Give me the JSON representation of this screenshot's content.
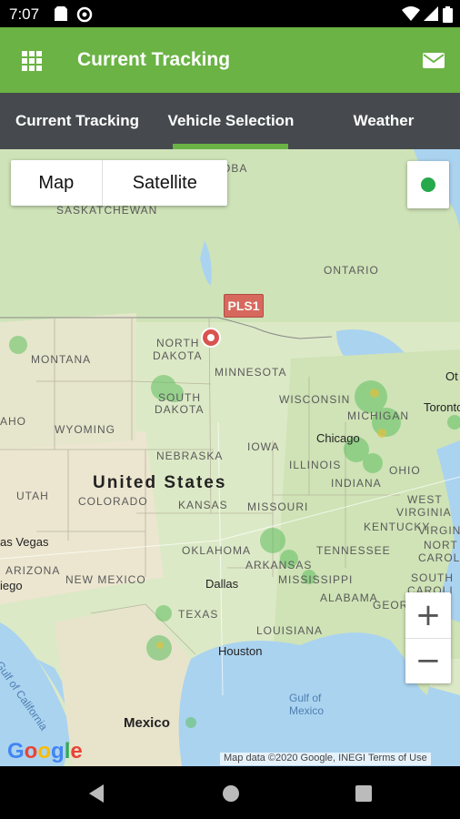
{
  "status_bar": {
    "time": "7:07"
  },
  "app_bar": {
    "title": "Current Tracking"
  },
  "tabs": [
    {
      "label": "Current Tracking",
      "selected": false
    },
    {
      "label": "Vehicle Selection",
      "selected": true
    },
    {
      "label": "Weather",
      "selected": false
    }
  ],
  "map": {
    "map_type": {
      "map_label": "Map",
      "satellite_label": "Satellite"
    },
    "vehicle_marker": {
      "label": "PLS1"
    },
    "zoom": {
      "in_label": "+",
      "out_label": "−"
    },
    "labels": {
      "us": "United States",
      "mexico": "Mexico",
      "saskatchewan": "SASKATCHEWAN",
      "manitoba": "OBA",
      "ontario": "ONTARIO",
      "montana": "MONTANA",
      "north_dakota_1": "NORTH",
      "north_dakota_2": "DAKOTA",
      "south_dakota_1": "SOUTH",
      "south_dakota_2": "DAKOTA",
      "minnesota": "MINNESOTA",
      "wisconsin": "WISCONSIN",
      "michigan": "MICHIGAN",
      "idaho": "AHO",
      "wyoming": "WYOMING",
      "nebraska": "NEBRASKA",
      "iowa": "IOWA",
      "illinois": "ILLINOIS",
      "indiana": "INDIANA",
      "ohio": "OHIO",
      "utah": "UTAH",
      "colorado": "COLORADO",
      "kansas": "KANSAS",
      "missouri": "MISSOURI",
      "west_virginia_1": "WEST",
      "west_virginia_2": "VIRGINIA",
      "virginia": "VIRGINI",
      "kentucky": "KENTUCKY",
      "oklahoma": "OKLAHOMA",
      "tennessee": "TENNESSEE",
      "north_carolina_1": "NORT",
      "north_carolina_2": "CAROL",
      "south_carolina_1": "SOUTH",
      "south_carolina_2": "CAROLI",
      "arizona": "ARIZONA",
      "new_mexico": "NEW MEXICO",
      "arkansas": "ARKANSAS",
      "mississippi": "MISSISSIPPI",
      "alabama": "ALABAMA",
      "georgia": "GEORGIA",
      "louisiana": "LOUISIANA",
      "texas": "TEXAS"
    },
    "cities": {
      "las_vegas": "as Vegas",
      "san_diego": "iego",
      "chicago": "Chicago",
      "toronto": "Toronto",
      "ottawa": "Ot",
      "dallas": "Dallas",
      "houston": "Houston"
    },
    "water": {
      "gulf_mexico_1": "Gulf of",
      "gulf_mexico_2": "Mexico",
      "gulf_california": "Gulf of California"
    },
    "attribution": "Map data ©2020 Google, INEGI   Terms of Use",
    "logo": "Google"
  },
  "colors": {
    "primary": "#6ab344",
    "tab_bar": "#464a4e",
    "gps_dot": "#25a94a"
  }
}
